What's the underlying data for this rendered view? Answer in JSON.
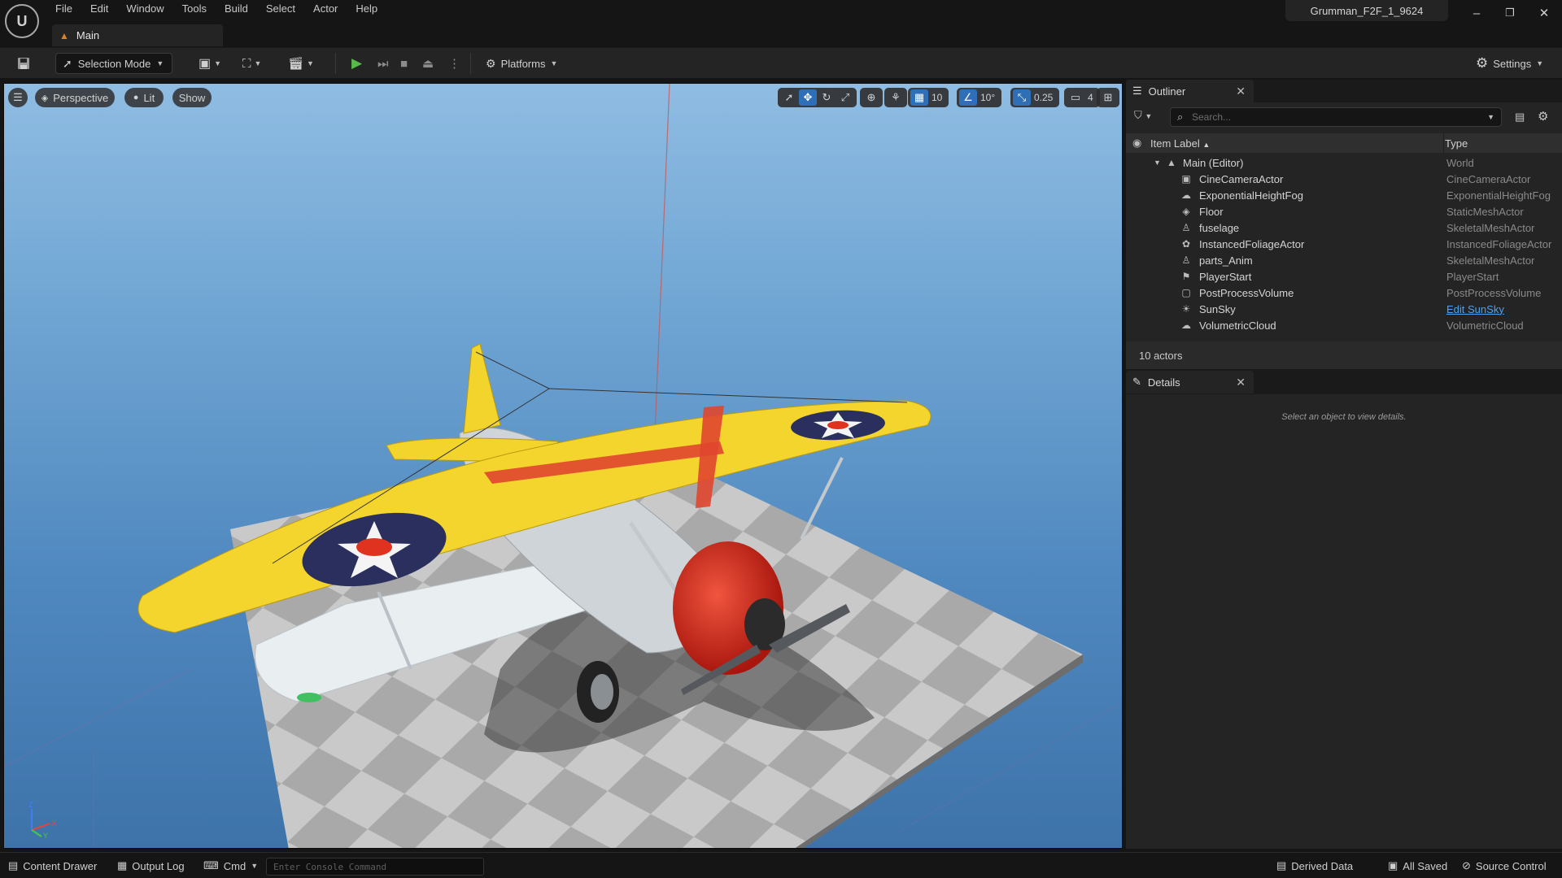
{
  "menu": [
    "File",
    "Edit",
    "Window",
    "Tools",
    "Build",
    "Select",
    "Actor",
    "Help"
  ],
  "document_tab": "Main",
  "project_name": "Grumman_F2F_1_9624",
  "window_buttons": {
    "minimize": "–",
    "restore": "❐",
    "close": "✕"
  },
  "toolbar": {
    "selection_mode": "Selection Mode",
    "platforms": "Platforms",
    "settings": "Settings"
  },
  "viewport": {
    "perspective": "Perspective",
    "lit": "Lit",
    "show": "Show",
    "grid_snap": "10",
    "rotation_snap": "10°",
    "scale_snap": "0.25",
    "camera_speed": "4",
    "axis_labels": {
      "z": "Z",
      "x": "X",
      "y": "Y"
    }
  },
  "outliner": {
    "tab_label": "Outliner",
    "search_placeholder": "Search...",
    "col_label": "Item Label",
    "col_type": "Type",
    "root": {
      "label": "Main (Editor)",
      "type": "World"
    },
    "items": [
      {
        "label": "CineCameraActor",
        "type": "CineCameraActor",
        "icon": "camera-icon"
      },
      {
        "label": "ExponentialHeightFog",
        "type": "ExponentialHeightFog",
        "icon": "fog-icon"
      },
      {
        "label": "Floor",
        "type": "StaticMeshActor",
        "icon": "cube-icon"
      },
      {
        "label": "fuselage",
        "type": "SkeletalMeshActor",
        "icon": "skeleton-icon"
      },
      {
        "label": "InstancedFoliageActor",
        "type": "InstancedFoliageActor",
        "icon": "foliage-icon"
      },
      {
        "label": "parts_Anim",
        "type": "SkeletalMeshActor",
        "icon": "skeleton-icon"
      },
      {
        "label": "PlayerStart",
        "type": "PlayerStart",
        "icon": "flag-icon"
      },
      {
        "label": "PostProcessVolume",
        "type": "PostProcessVolume",
        "icon": "volume-icon"
      },
      {
        "label": "SunSky",
        "type": "Edit SunSky",
        "icon": "sun-icon"
      },
      {
        "label": "VolumetricCloud",
        "type": "VolumetricCloud",
        "icon": "cloud-icon"
      }
    ],
    "footer": "10 actors"
  },
  "details": {
    "tab_label": "Details",
    "empty_message": "Select an object to view details."
  },
  "statusbar": {
    "content_drawer": "Content Drawer",
    "output_log": "Output Log",
    "cmd": "Cmd",
    "console_placeholder": "Enter Console Command",
    "derived_data": "Derived Data",
    "all_saved": "All Saved",
    "source_control": "Source Control"
  }
}
